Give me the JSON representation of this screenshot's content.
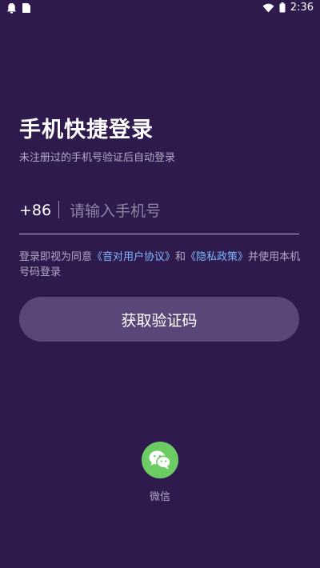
{
  "status_bar": {
    "time": "2:36",
    "icons": [
      "notification-icon",
      "sim-icon",
      "wifi-icon",
      "battery-icon"
    ]
  },
  "login": {
    "title": "手机快捷登录",
    "subtitle": "未注册过的手机号验证后自动登录",
    "country_code": "+86",
    "phone_placeholder": "请输入手机号",
    "phone_value": ""
  },
  "agreement": {
    "prefix": "登录即视为同意",
    "user_agreement": "《音对用户协议》",
    "and": "和",
    "privacy_policy": "《隐私政策》",
    "suffix": "并使用本机号码登录"
  },
  "buttons": {
    "get_code": "获取验证码"
  },
  "third_party": {
    "wechat_label": "微信"
  },
  "colors": {
    "background": "#2f1a4e",
    "button": "#5a4679",
    "link": "#7fb6ff",
    "wechat": "#6ccb62"
  }
}
